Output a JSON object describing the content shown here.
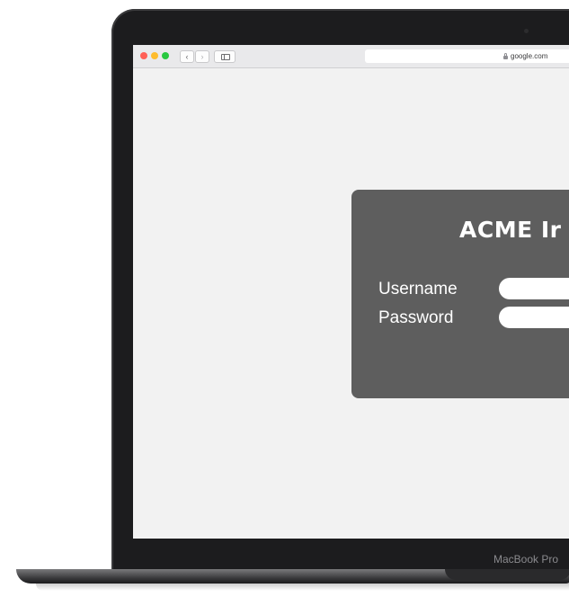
{
  "browser": {
    "url": "google.com",
    "back_glyph": "‹",
    "forward_glyph": "›"
  },
  "login_card": {
    "title": "ACME Ir",
    "username_label": "Username",
    "password_label": "Password",
    "username_value": "",
    "password_value": ""
  },
  "device": {
    "brand_label": "MacBook Pro"
  },
  "icons": [
    "lock-icon",
    "sidebar-icon",
    "chevron-left-icon",
    "chevron-right-icon"
  ],
  "colors": {
    "card_bg": "#5e5e5e",
    "page_bg": "#f2f2f2",
    "bezel": "#1c1c1e",
    "traffic_red": "#ff5f57",
    "traffic_yellow": "#febc2e",
    "traffic_green": "#28c840"
  }
}
